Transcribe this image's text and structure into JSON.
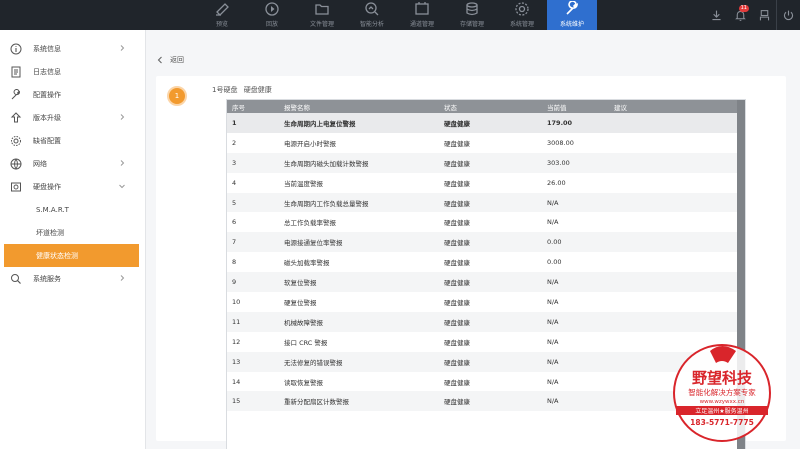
{
  "topnav": {
    "items": [
      {
        "label": "预览",
        "icon": "camera-icon"
      },
      {
        "label": "回放",
        "icon": "playback-icon"
      },
      {
        "label": "文件管理",
        "icon": "folder-icon"
      },
      {
        "label": "智能分析",
        "icon": "analysis-icon"
      },
      {
        "label": "通道管理",
        "icon": "channel-icon"
      },
      {
        "label": "存储管理",
        "icon": "database-icon"
      },
      {
        "label": "系统管理",
        "icon": "gear-icon"
      },
      {
        "label": "系统维护",
        "icon": "wrench-icon"
      }
    ],
    "active_index": 7,
    "notification_count": "11"
  },
  "sidebar": {
    "items": [
      {
        "label": "系统信息",
        "icon": "info-icon"
      },
      {
        "label": "日志信息",
        "icon": "log-icon"
      },
      {
        "label": "配置操作",
        "icon": "tool-icon"
      },
      {
        "label": "版本升级",
        "icon": "upgrade-icon"
      },
      {
        "label": "缺省配置",
        "icon": "default-config-icon"
      },
      {
        "label": "网络",
        "icon": "globe-icon"
      },
      {
        "label": "硬盘操作",
        "icon": "disk-icon"
      }
    ],
    "disk_sub": [
      {
        "label": "S.M.A.R.T"
      },
      {
        "label": "坏道检测"
      },
      {
        "label": "健康状态检测"
      }
    ],
    "last": {
      "label": "系统服务",
      "icon": "service-icon"
    }
  },
  "main": {
    "back_label": "返回",
    "step_number": "1",
    "crumb_disk": "1号硬盘",
    "crumb_status": "硬盘健康",
    "table": {
      "headers": [
        "序号",
        "报警名称",
        "状态",
        "当前值",
        "建议"
      ],
      "rows": [
        [
          "1",
          "生命周期内上电复位警报",
          "硬盘健康",
          "179.00",
          ""
        ],
        [
          "2",
          "电源开启小时警报",
          "硬盘健康",
          "3008.00",
          ""
        ],
        [
          "3",
          "生命周期内磁头加载计数警报",
          "硬盘健康",
          "303.00",
          ""
        ],
        [
          "4",
          "当前温度警报",
          "硬盘健康",
          "26.00",
          ""
        ],
        [
          "5",
          "生命周期内工作负载总量警报",
          "硬盘健康",
          "N/A",
          ""
        ],
        [
          "6",
          "总工作负载率警报",
          "硬盘健康",
          "N/A",
          ""
        ],
        [
          "7",
          "电源接通复位率警报",
          "硬盘健康",
          "0.00",
          ""
        ],
        [
          "8",
          "磁头加载率警报",
          "硬盘健康",
          "0.00",
          ""
        ],
        [
          "9",
          "软复位警报",
          "硬盘健康",
          "N/A",
          ""
        ],
        [
          "10",
          "硬复位警报",
          "硬盘健康",
          "N/A",
          ""
        ],
        [
          "11",
          "机械故障警报",
          "硬盘健康",
          "N/A",
          ""
        ],
        [
          "12",
          "接口 CRC 警报",
          "硬盘健康",
          "N/A",
          ""
        ],
        [
          "13",
          "无法修复的错误警报",
          "硬盘健康",
          "N/A",
          ""
        ],
        [
          "14",
          "读取恢复警报",
          "硬盘健康",
          "N/A",
          ""
        ],
        [
          "15",
          "重新分配扇区计数警报",
          "硬盘健康",
          "N/A",
          ""
        ]
      ]
    }
  },
  "watermark": {
    "brand": "野望科技",
    "tagline": "智能化解决方案专家",
    "url": "www.wzywxx.cn",
    "banner": "立足温州★服务温州",
    "phone": "183-5771-7775",
    "color": "#d9252b"
  }
}
